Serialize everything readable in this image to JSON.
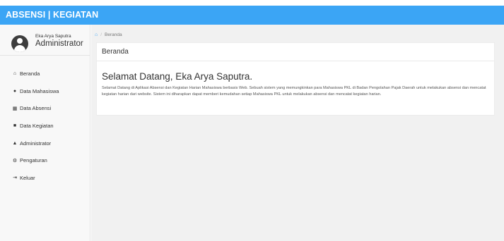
{
  "header": {
    "brand": "ABSENSI | KEGIATAN"
  },
  "user": {
    "name": "Eka Arya Saputra",
    "role": "Administrator"
  },
  "sidebar": {
    "items": [
      {
        "icon": "home-icon",
        "glyph": "⌂",
        "label": "Beranda"
      },
      {
        "icon": "users-icon",
        "glyph": "●",
        "label": "Data Mahasiswa"
      },
      {
        "icon": "calendar-icon",
        "glyph": "▦",
        "label": "Data Absensi"
      },
      {
        "icon": "book-icon",
        "glyph": "■",
        "label": "Data Kegiatan"
      },
      {
        "icon": "user-icon",
        "glyph": "▲",
        "label": "Administrator"
      },
      {
        "icon": "gear-icon",
        "glyph": "⚙",
        "label": "Pengaturan"
      },
      {
        "icon": "logout-icon",
        "glyph": "⇥",
        "label": "Keluar"
      }
    ]
  },
  "breadcrumb": {
    "home_glyph": "⌂",
    "separator": "/",
    "current": "Beranda"
  },
  "panel": {
    "title": "Beranda",
    "welcome": "Selamat Datang, Eka Arya Saputra.",
    "description": "Selamat Datang di Aplikasi Absensi dan Kegiatan Harian Mahasiswa berbasis Web. Sebuah sistem yang memungkinkan para Mahasiswa PKL di Badan Pengolahan Pajak Daerah untuk melakukan absensi dan mencatat kegiatan harian dari website. Sistem ini diharapkan dapat memberi kemudahan setiap Mahasiswa PKL untuk melakukan absensi dan mencatat kegiatan harian."
  },
  "colors": {
    "accent": "#3ba5f5",
    "sidebar_bg": "#f8f8f8",
    "content_bg": "#f1f1f1"
  }
}
